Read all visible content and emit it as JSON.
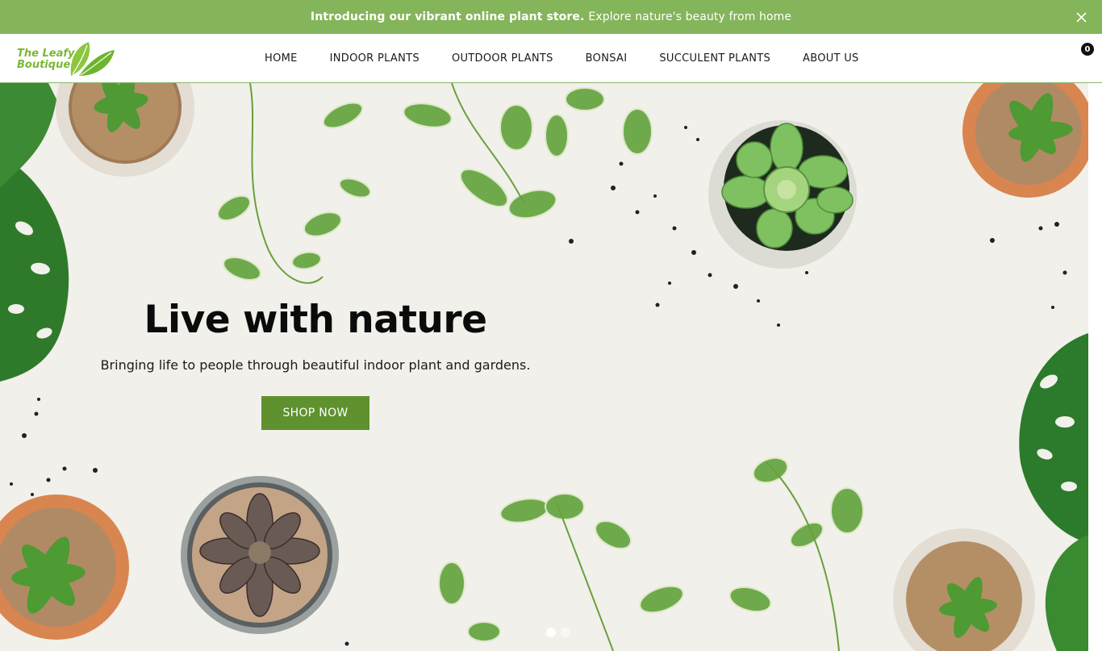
{
  "announcement": {
    "bold_text": "Introducing our vibrant online plant store.",
    "text": "Explore nature's beauty from home",
    "close_icon": "close-icon"
  },
  "logo": {
    "line1": "The Leafy",
    "line2": "Boutique"
  },
  "nav": {
    "items": [
      {
        "label": "HOME"
      },
      {
        "label": "INDOOR PLANTS"
      },
      {
        "label": "OUTDOOR PLANTS"
      },
      {
        "label": "BONSAI"
      },
      {
        "label": "SUCCULENT PLANTS"
      },
      {
        "label": "ABOUT US"
      }
    ]
  },
  "cart": {
    "count": "0",
    "icon": "cart-icon"
  },
  "hero": {
    "title": "Live with nature",
    "subtitle": "Bringing life to people through beautiful indoor plant and gardens.",
    "cta_label": "SHOP NOW",
    "slides_total": 2,
    "active_slide": 1
  },
  "colors": {
    "announcement_bg": "#84b55a",
    "brand_green": "#7ab833",
    "cta_bg": "#5f922e",
    "hero_bg": "#f1f0ea"
  }
}
